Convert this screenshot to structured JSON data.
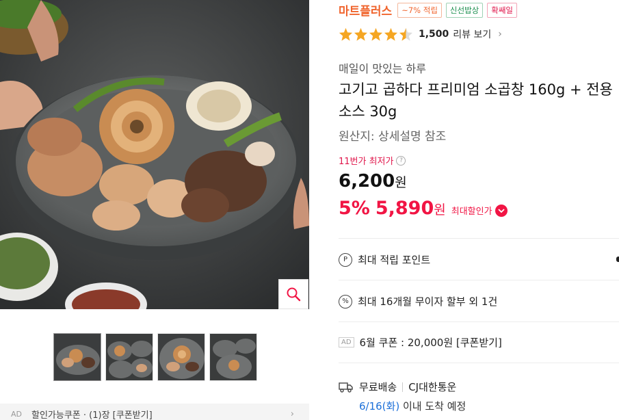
{
  "gallery": {
    "thumbnail_count": 4,
    "coupon_strip": {
      "ad": "AD",
      "text": "할인가능쿠폰 · (1)장 [쿠폰받기]"
    }
  },
  "product": {
    "brand": "마트플러스",
    "tags": [
      "~7% 적립",
      "신선밥상",
      "확쌔일"
    ],
    "rating": {
      "stars": 4.5,
      "count": "1,500",
      "label": "리뷰 보기"
    },
    "subtitle": "매일이 맛있는 하루",
    "title": "고기고 곱하다 프리미엄 소곱창 160g + 전용소스 30g",
    "origin": "원산지: 상세설명 참조",
    "lowest_label": "11번가 최저가",
    "original_price": "6,200",
    "won": "원",
    "discount_rate": "5%",
    "sale_price": "5,890",
    "max_discount_label": "최대할인가"
  },
  "benefits": {
    "points": {
      "icon": "P",
      "label": "최대 적립 포인트"
    },
    "installment": {
      "icon": "%",
      "label": "최대 16개월 무이자 할부 외 1건"
    },
    "coupon": {
      "ad": "AD",
      "label": "6월 쿠폰 : 20,000원 [쿠폰받기]"
    }
  },
  "shipping": {
    "type": "무료배송",
    "carrier": "CJ대한통운",
    "eta_date": "6/16(화)",
    "eta_text": " 이내 도착 예정"
  },
  "colors": {
    "brand": "#f0642d",
    "sale": "#f11544",
    "star": "#f5a623",
    "eta_date": "#1b6fd8"
  }
}
